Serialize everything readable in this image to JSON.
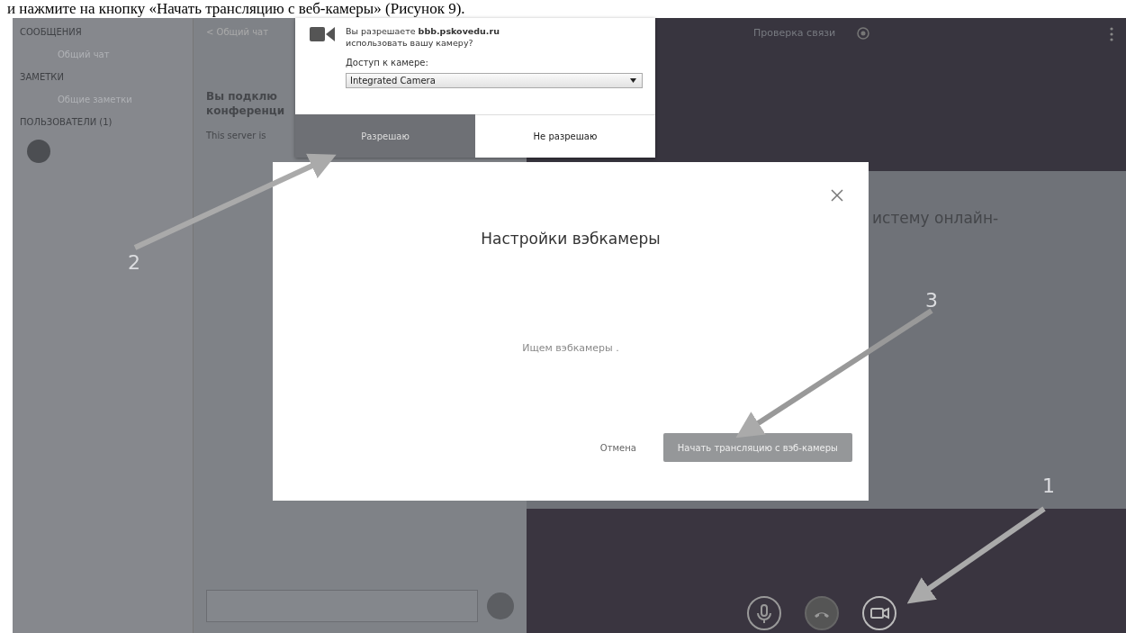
{
  "instruction": "и нажмите на кнопку «Начать трансляцию с веб-камеры» (Рисунок 9).",
  "sidebar": {
    "sections": [
      {
        "heading": "СООБЩЕНИЯ",
        "items": [
          "Общий чат"
        ]
      },
      {
        "heading": "ЗАМЕТКИ",
        "items": [
          "Общие заметки"
        ]
      },
      {
        "heading": "ПОЛЬЗОВАТЕЛИ (1)"
      }
    ]
  },
  "chat": {
    "back_label": "< Общий чат",
    "welcome": [
      "Вы подклю",
      "конференци"
    ],
    "server_note": "This server is"
  },
  "topbar": {
    "title": "Проверка связи"
  },
  "presentation": {
    "text": "истему онлайн-"
  },
  "popup": {
    "question": "Вы разрешаете **bbb.pskovedu.ru** использовать вашу камеру?",
    "access_label": "Доступ к камере:",
    "camera": "Integrated Camera",
    "buttons": [
      {
        "label": "Разрешаю",
        "kind": "primary"
      },
      {
        "label": "Не разрешаю",
        "kind": "secondary"
      }
    ]
  },
  "modal": {
    "title": "Настройки вэбкамеры",
    "status": "Ищем вэбкамеры .",
    "cancel": "Отмена",
    "start": "Начать трансляцию с вэб-камеры"
  },
  "callouts": [
    "1",
    "2",
    "3"
  ]
}
